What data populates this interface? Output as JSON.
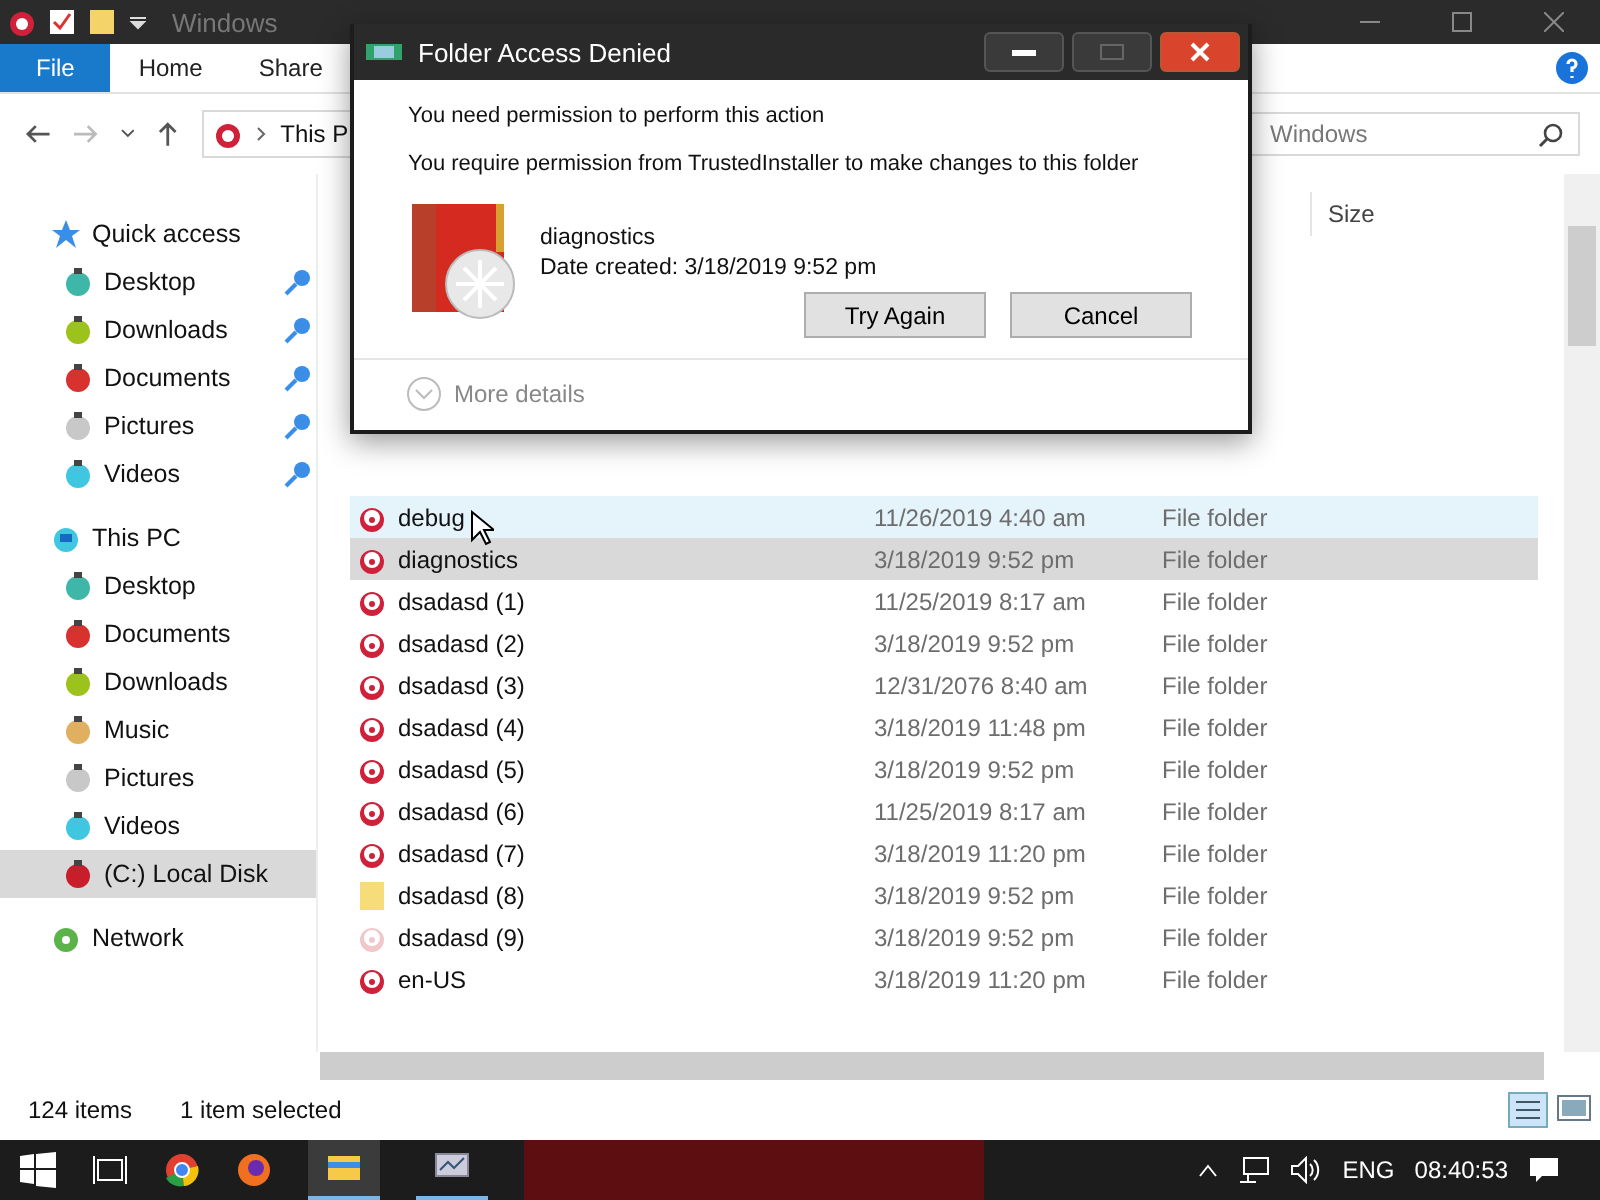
{
  "window": {
    "title": "Windows"
  },
  "ribbon_tabs": [
    {
      "label": "File",
      "selected": true
    },
    {
      "label": "Home",
      "selected": false
    },
    {
      "label": "Share",
      "selected": false
    }
  ],
  "address_bar": {
    "path": "This P"
  },
  "search": {
    "placeholder": "Windows"
  },
  "columns": [
    {
      "label": "Size"
    }
  ],
  "sidebar": {
    "items": [
      {
        "label": "Quick access",
        "kind": "star",
        "selected": false,
        "children": [
          {
            "label": "Desktop",
            "color": "#3fb7a8",
            "pinned": true,
            "selected": false
          },
          {
            "label": "Downloads",
            "color": "#9cc21c",
            "pinned": true,
            "selected": false
          },
          {
            "label": "Documents",
            "color": "#d8322f",
            "pinned": true,
            "selected": false
          },
          {
            "label": "Pictures",
            "color": "#c8c8c8",
            "pinned": true,
            "selected": false
          },
          {
            "label": "Videos",
            "color": "#3fc6e0",
            "pinned": true,
            "selected": false
          }
        ]
      },
      {
        "label": "This PC",
        "kind": "pc",
        "selected": false,
        "children": [
          {
            "label": "Desktop",
            "color": "#3fb7a8",
            "pinned": false,
            "selected": false
          },
          {
            "label": "Documents",
            "color": "#d8322f",
            "pinned": false,
            "selected": false
          },
          {
            "label": "Downloads",
            "color": "#9cc21c",
            "pinned": false,
            "selected": false
          },
          {
            "label": "Music",
            "color": "#e0b060",
            "pinned": false,
            "selected": false
          },
          {
            "label": "Pictures",
            "color": "#c8c8c8",
            "pinned": false,
            "selected": false
          },
          {
            "label": "Videos",
            "color": "#3fc6e0",
            "pinned": false,
            "selected": false
          },
          {
            "label": "(C:) Local Disk",
            "color": "#c81d2a",
            "pinned": false,
            "selected": true
          }
        ]
      },
      {
        "label": "Network",
        "kind": "network",
        "selected": false
      }
    ]
  },
  "files": [
    {
      "name": "debug",
      "date": "11/26/2019 4:40 am",
      "type": "File folder",
      "kind": "ornament",
      "selected": false,
      "hovered": true
    },
    {
      "name": "diagnostics",
      "date": "3/18/2019 9:52 pm",
      "type": "File folder",
      "kind": "ornament",
      "selected": true,
      "hovered": false
    },
    {
      "name": "dsadasd (1)",
      "date": "11/25/2019 8:17 am",
      "type": "File folder",
      "kind": "ornament",
      "selected": false,
      "hovered": false
    },
    {
      "name": "dsadasd (2)",
      "date": "3/18/2019 9:52 pm",
      "type": "File folder",
      "kind": "ornament",
      "selected": false,
      "hovered": false
    },
    {
      "name": "dsadasd (3)",
      "date": "12/31/2076 8:40 am",
      "type": "File folder",
      "kind": "ornament",
      "selected": false,
      "hovered": false
    },
    {
      "name": "dsadasd (4)",
      "date": "3/18/2019 11:48 pm",
      "type": "File folder",
      "kind": "ornament",
      "selected": false,
      "hovered": false
    },
    {
      "name": "dsadasd (5)",
      "date": "3/18/2019 9:52 pm",
      "type": "File folder",
      "kind": "ornament",
      "selected": false,
      "hovered": false
    },
    {
      "name": "dsadasd (6)",
      "date": "11/25/2019 8:17 am",
      "type": "File folder",
      "kind": "ornament",
      "selected": false,
      "hovered": false
    },
    {
      "name": "dsadasd (7)",
      "date": "3/18/2019 11:20 pm",
      "type": "File folder",
      "kind": "ornament",
      "selected": false,
      "hovered": false
    },
    {
      "name": "dsadasd (8)",
      "date": "3/18/2019 9:52 pm",
      "type": "File folder",
      "kind": "folder",
      "selected": false,
      "hovered": false
    },
    {
      "name": "dsadasd (9)",
      "date": "3/18/2019 9:52 pm",
      "type": "File folder",
      "kind": "faint",
      "selected": false,
      "hovered": false
    },
    {
      "name": "en-US",
      "date": "3/18/2019 11:20 pm",
      "type": "File folder",
      "kind": "ornament",
      "selected": false,
      "hovered": false
    }
  ],
  "status_bar": {
    "count": "124 items",
    "selection": "1 item selected"
  },
  "dialog": {
    "title": "Folder Access Denied",
    "heading": "You need permission to perform this action",
    "message": "You require permission from TrustedInstaller to make changes to this folder",
    "item_name": "diagnostics",
    "item_date": "Date created: 3/18/2019 9:52 pm",
    "buttons": [
      "Try Again",
      "Cancel"
    ],
    "details": "More details"
  },
  "taskbar": {
    "language": "ENG",
    "clock": "08:40:53"
  }
}
